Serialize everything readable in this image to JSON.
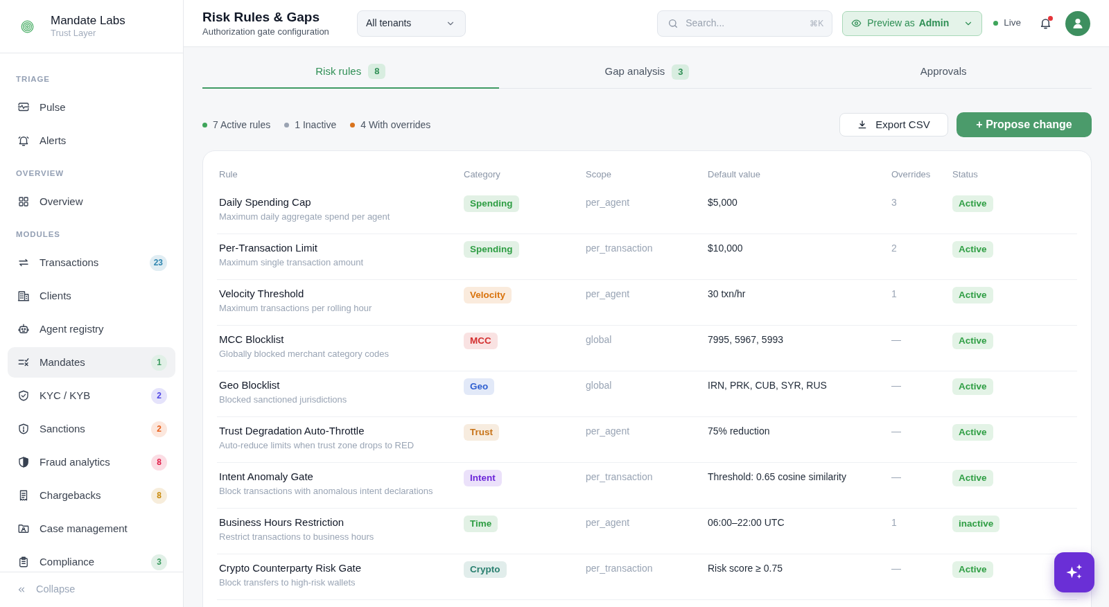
{
  "brand": {
    "name": "Mandate Labs",
    "tagline": "Trust Layer"
  },
  "sidebar": {
    "sections": [
      {
        "heading": "TRIAGE",
        "items": [
          {
            "label": "Pulse",
            "selected": false
          },
          {
            "label": "Alerts",
            "selected": false
          }
        ]
      },
      {
        "heading": "OVERVIEW",
        "items": [
          {
            "label": "Overview",
            "selected": false
          }
        ]
      },
      {
        "heading": "MODULES",
        "items": [
          {
            "label": "Transactions",
            "count": "23",
            "color": "#2f86b0",
            "selected": false
          },
          {
            "label": "Clients",
            "selected": false
          },
          {
            "label": "Agent registry",
            "selected": false
          },
          {
            "label": "Mandates",
            "count": "1",
            "color": "#3a9a5e",
            "selected": true
          },
          {
            "label": "KYC / KYB",
            "count": "2",
            "color": "#4f46e5",
            "selected": false
          },
          {
            "label": "Sanctions",
            "count": "2",
            "color": "#e8601c",
            "selected": false
          },
          {
            "label": "Fraud analytics",
            "count": "8",
            "color": "#e11d48",
            "selected": false
          },
          {
            "label": "Chargebacks",
            "count": "8",
            "color": "#c98a0c",
            "selected": false
          },
          {
            "label": "Case management",
            "selected": false
          },
          {
            "label": "Compliance",
            "count": "3",
            "color": "#3a9a5e",
            "selected": false
          }
        ]
      }
    ],
    "collapse_label": "Collapse"
  },
  "header": {
    "title": "Risk Rules & Gaps",
    "subtitle": "Authorization gate configuration",
    "tenant_select": {
      "value": "All tenants"
    },
    "search": {
      "placeholder": "Search...",
      "shortcut": "⌘K"
    },
    "preview": {
      "label": "Preview as",
      "role": "Admin"
    },
    "live": {
      "label": "Live"
    },
    "notifications": {
      "unread": true
    }
  },
  "tabs": [
    {
      "label": "Risk rules",
      "count": "8",
      "selected": true
    },
    {
      "label": "Gap analysis",
      "count": "3",
      "selected": false
    },
    {
      "label": "Approvals",
      "selected": false
    }
  ],
  "summary": [
    {
      "label": "7 Active rules",
      "color": "#3fa55b"
    },
    {
      "label": "1 Inactive",
      "color": "#9aa3b2"
    },
    {
      "label": "4 With overrides",
      "color": "#d9731d"
    }
  ],
  "actions": {
    "export": "Export CSV",
    "propose": "+ Propose change"
  },
  "table": {
    "columns": [
      "Rule",
      "Category",
      "Scope",
      "Default value",
      "Overrides",
      "Status"
    ],
    "rows": [
      {
        "name": "Daily Spending Cap",
        "description": "Maximum daily aggregate spend per agent",
        "category": {
          "label": "Spending",
          "color": "#2f9e44"
        },
        "scope": "per_agent",
        "default_value": "$5,000",
        "overrides": "3",
        "status": "Active"
      },
      {
        "name": "Per-Transaction Limit",
        "description": "Maximum single transaction amount",
        "category": {
          "label": "Spending",
          "color": "#2f9e44"
        },
        "scope": "per_transaction",
        "default_value": "$10,000",
        "overrides": "2",
        "status": "Active"
      },
      {
        "name": "Velocity Threshold",
        "description": "Maximum transactions per rolling hour",
        "category": {
          "label": "Velocity",
          "color": "#d9730d"
        },
        "scope": "per_agent",
        "default_value": "30 txn/hr",
        "overrides": "1",
        "status": "Active"
      },
      {
        "name": "MCC Blocklist",
        "description": "Globally blocked merchant category codes",
        "category": {
          "label": "MCC",
          "color": "#d32f2f"
        },
        "scope": "global",
        "default_value": "7995, 5967, 5993",
        "overrides": "—",
        "status": "Active"
      },
      {
        "name": "Geo Blocklist",
        "description": "Blocked sanctioned jurisdictions",
        "category": {
          "label": "Geo",
          "color": "#2f5fd0"
        },
        "scope": "global",
        "default_value": "IRN, PRK, CUB, SYR, RUS",
        "overrides": "—",
        "status": "Active"
      },
      {
        "name": "Trust Degradation Auto-Throttle",
        "description": "Auto-reduce limits when trust zone drops to RED",
        "category": {
          "label": "Trust",
          "color": "#c8741a"
        },
        "scope": "per_agent",
        "default_value": "75% reduction",
        "overrides": "—",
        "status": "Active"
      },
      {
        "name": "Intent Anomaly Gate",
        "description": "Block transactions with anomalous intent declarations",
        "category": {
          "label": "Intent",
          "color": "#6d28d9"
        },
        "scope": "per_transaction",
        "default_value": "Threshold: 0.65 cosine similarity",
        "overrides": "—",
        "status": "Active"
      },
      {
        "name": "Business Hours Restriction",
        "description": "Restrict transactions to business hours",
        "category": {
          "label": "Time",
          "color": "#2f9e44"
        },
        "scope": "per_agent",
        "default_value": "06:00–22:00 UTC",
        "overrides": "1",
        "status": "inactive"
      },
      {
        "name": "Crypto Counterparty Risk Gate",
        "description": "Block transfers to high-risk wallets",
        "category": {
          "label": "Crypto",
          "color": "#2a8070"
        },
        "scope": "per_transaction",
        "default_value": "Risk score ≥ 0.75",
        "overrides": "—",
        "status": "Active"
      }
    ]
  }
}
